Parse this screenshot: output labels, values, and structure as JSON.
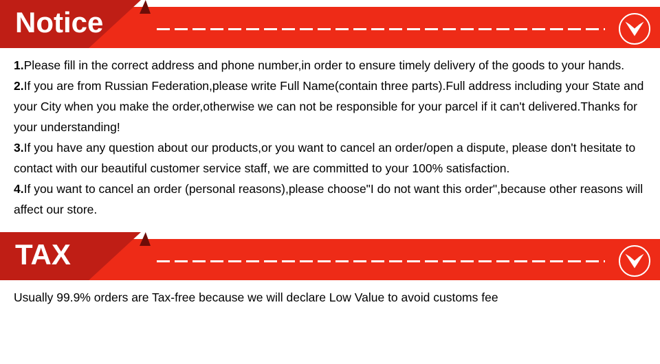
{
  "sections": [
    {
      "id": "notice",
      "banner": {
        "title": "Notice",
        "badge_icon": "chevron-down-icon",
        "divider": "dashed-line"
      },
      "paragraphs": [
        {
          "number": "1.",
          "text": "Please fill in the correct address and phone number,in order to ensure timely delivery of the goods to your hands."
        },
        {
          "number": "2.",
          "text": "If you are from Russian Federation,please write Full Name(contain three parts).Full address including your State and your City when you make the order,otherwise we can not be responsible for your parcel if it can't delivered.Thanks for your understanding!"
        },
        {
          "number": "3.",
          "text": "If you have any question about our products,or you want to cancel an order/open a dispute, please don't hesitate to contact with our beautiful customer service staff, we are committed to your 100% satisfaction."
        },
        {
          "number": "4.",
          "text": "If you want to cancel an order (personal reasons),please choose\"I do not want this order\",because other reasons will affect our store."
        }
      ]
    },
    {
      "id": "tax",
      "banner": {
        "title": "TAX",
        "badge_icon": "chevron-down-icon",
        "divider": "dashed-line"
      },
      "paragraphs": [
        {
          "number": "",
          "text": "Usually 99.9% orders are Tax-free because we will declare Low Value to avoid customs fee"
        }
      ]
    }
  ],
  "colors": {
    "dark_red": "#bf1e15",
    "bright_red": "#ee2b17",
    "fold_shadow": "#6d0d08",
    "text": "#000000",
    "background": "#ffffff"
  }
}
